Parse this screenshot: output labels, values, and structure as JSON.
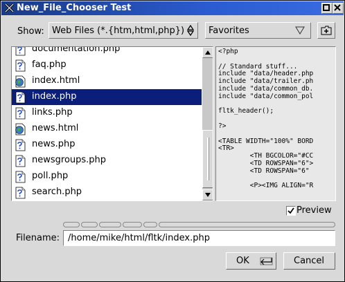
{
  "window": {
    "title": "New_File_Chooser Test"
  },
  "toolbar": {
    "show_label": "Show:",
    "filter_value": "Web Files (*.{htm,html,php})",
    "favorites_label": "Favorites",
    "new_folder_icon": "new-folder-icon"
  },
  "files": [
    {
      "name": "documentation.php",
      "icon": "document-icon",
      "selected": false
    },
    {
      "name": "faq.php",
      "icon": "document-icon",
      "selected": false
    },
    {
      "name": "index.html",
      "icon": "web-page-icon",
      "selected": false
    },
    {
      "name": "index.php",
      "icon": "document-icon",
      "selected": true
    },
    {
      "name": "links.php",
      "icon": "document-icon",
      "selected": false
    },
    {
      "name": "news.html",
      "icon": "web-page-icon",
      "selected": false
    },
    {
      "name": "news.php",
      "icon": "document-icon",
      "selected": false
    },
    {
      "name": "newsgroups.php",
      "icon": "document-icon",
      "selected": false
    },
    {
      "name": "poll.php",
      "icon": "document-icon",
      "selected": false
    },
    {
      "name": "search.php",
      "icon": "document-icon",
      "selected": false
    }
  ],
  "preview_text": "<?php\n\n// Standard stuff...\ninclude \"data/header.php\nin­clude \"data/trailer.ph\ninclude \"data/common_db.\ninclude \"data/common_pol\n\nfltk_header();\n\n?>\n\n<TABLE WIDTH=\"100%\" BORD\n<TR>\n        <TH BGCOLOR=\"#CC\n        <TD ROWSPAN=\"6\">\n        <TD ROWSPAN=\"6\"\n\n        <P><IMG ALIGN=\"R",
  "preview_toggle": {
    "label": "Preview",
    "checked": true
  },
  "filename": {
    "label": "Filename:",
    "value": "/home/mike/html/fltk/index.php"
  },
  "buttons": {
    "ok": "OK",
    "cancel": "Cancel"
  },
  "colors": {
    "titlebar": "#2b5bd0",
    "selection": "#0a1e7a",
    "background": "#d9d9d9"
  }
}
